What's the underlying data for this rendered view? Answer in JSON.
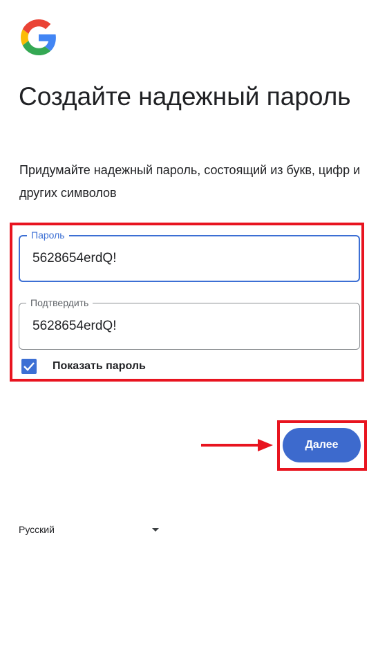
{
  "logo": {
    "icon": "google-g-icon",
    "colors": {
      "blue": "#4285F4",
      "red": "#EA4335",
      "yellow": "#FBBC05",
      "green": "#34A853"
    }
  },
  "title": "Создайте надежный пароль",
  "subtitle": "Придумайте надежный пароль, состоящий из букв, цифр и других символов",
  "password_field": {
    "label": "Пароль",
    "value": "5628654erdQ!",
    "focused": true
  },
  "confirm_field": {
    "label": "Подтвердить",
    "value": "5628654erdQ!"
  },
  "show_password": {
    "label": "Показать пароль",
    "checked": true,
    "icon": "checkmark-icon"
  },
  "next_button": {
    "label": "Далее"
  },
  "language": {
    "selected": "Русский",
    "icon": "caret-down-icon"
  },
  "colors": {
    "accent": "#3c6fd4",
    "button": "#3d6acd",
    "annotation": "#e8141f"
  }
}
